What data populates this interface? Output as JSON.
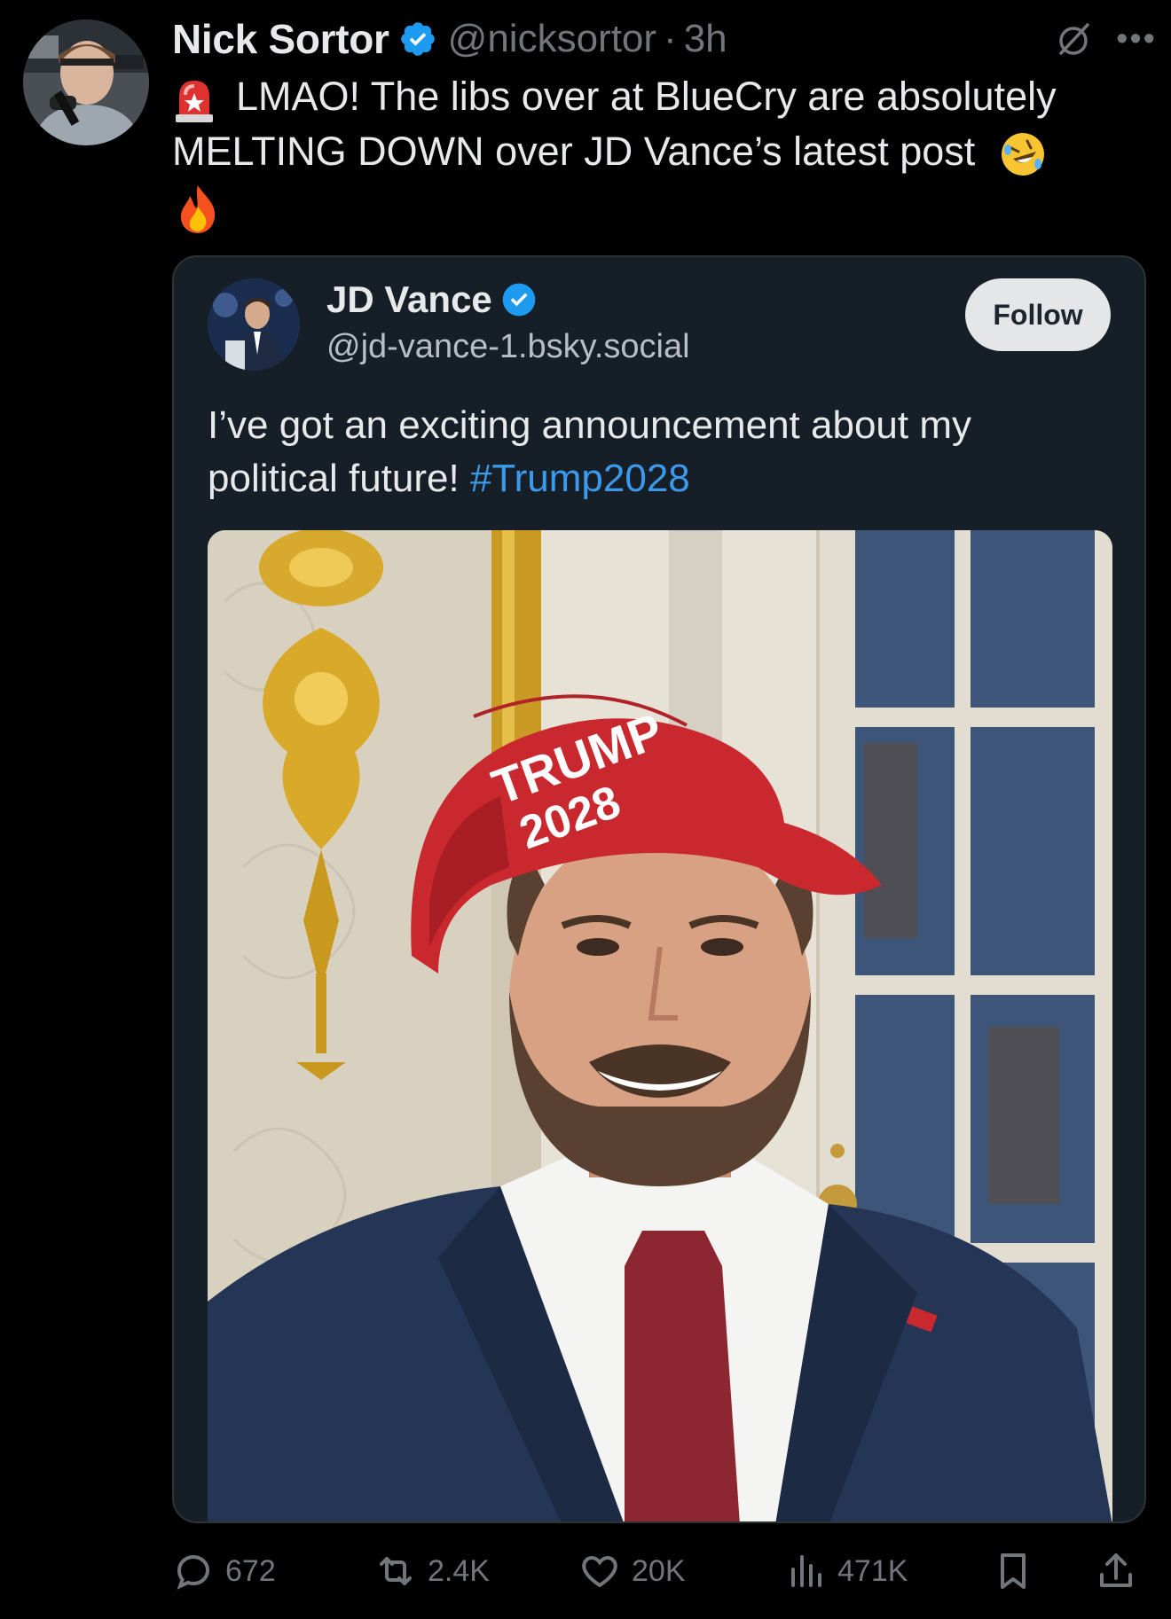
{
  "tweet": {
    "author_name": "Nick Sortor",
    "handle": "@nicksortor",
    "separator": "·",
    "time": "3h",
    "text_line1": "LMAO! The libs over at BlueCry are absolutely",
    "text_line2": "MELTING DOWN over JD Vance’s latest post"
  },
  "quote": {
    "author_name": "JD Vance",
    "handle": "@jd-vance-1.bsky.social",
    "follow_label": "Follow",
    "text": "I’ve got an exciting announcement about my political future!",
    "hashtag": "#Trump2028",
    "image_hat_text": "TRUMP 2028"
  },
  "actions": {
    "replies": "672",
    "reposts": "2.4K",
    "likes": "20K",
    "views": "471K"
  },
  "colors": {
    "background": "#000000",
    "card": "#161e27",
    "verified": "#1d9bf0",
    "hashtag": "#3b9aeb",
    "muted": "#71767b"
  },
  "icons": [
    "siren-emoji",
    "rofl-emoji",
    "fire-emoji",
    "verified-icon",
    "grok-icon",
    "more-icon",
    "reply-icon",
    "repost-icon",
    "like-icon",
    "views-icon",
    "bookmark-icon",
    "share-icon"
  ]
}
